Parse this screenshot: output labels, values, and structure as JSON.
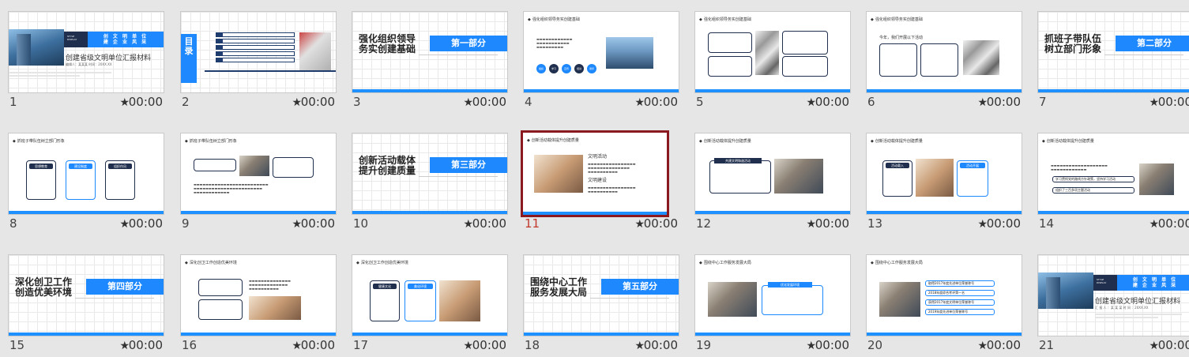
{
  "star_glyph": "★",
  "slides": [
    {
      "number": "1",
      "time": "00:00",
      "kind": "cover"
    },
    {
      "number": "2",
      "time": "00:00",
      "kind": "toc"
    },
    {
      "number": "3",
      "time": "00:00",
      "kind": "section"
    },
    {
      "number": "4",
      "time": "00:00",
      "kind": "content"
    },
    {
      "number": "5",
      "time": "00:00",
      "kind": "content"
    },
    {
      "number": "6",
      "time": "00:00",
      "kind": "content"
    },
    {
      "number": "7",
      "time": "00:00",
      "kind": "section"
    },
    {
      "number": "8",
      "time": "00:00",
      "kind": "content"
    },
    {
      "number": "9",
      "time": "00:00",
      "kind": "content"
    },
    {
      "number": "10",
      "time": "00:00",
      "kind": "section"
    },
    {
      "number": "11",
      "time": "00:00",
      "kind": "content",
      "selected": true
    },
    {
      "number": "12",
      "time": "00:00",
      "kind": "content"
    },
    {
      "number": "13",
      "time": "00:00",
      "kind": "content"
    },
    {
      "number": "14",
      "time": "00:00",
      "kind": "content"
    },
    {
      "number": "15",
      "time": "00:00",
      "kind": "section"
    },
    {
      "number": "16",
      "time": "00:00",
      "kind": "content"
    },
    {
      "number": "17",
      "time": "00:00",
      "kind": "content"
    },
    {
      "number": "18",
      "time": "00:00",
      "kind": "section"
    },
    {
      "number": "19",
      "time": "00:00",
      "kind": "content"
    },
    {
      "number": "20",
      "time": "00:00",
      "kind": "content"
    },
    {
      "number": "21",
      "time": "00:00",
      "kind": "cover"
    }
  ],
  "cover": {
    "badge": "STYLE\nDISPLAY",
    "band_line1": "创 文 明 单 位",
    "band_line2": "建 企 业 风 采",
    "title": "创建省级文明单位汇报材料",
    "meta": "编辑人：某某某  时间：20XX.XX",
    "closing_meta": "汇 报 人 ：某 某 某 时 间 ：20XX.XX"
  },
  "toc": {
    "label": "目录"
  },
  "sections": {
    "s3": {
      "title": "强化组织领导\n务实创建基础",
      "badge": "第一部分"
    },
    "s7": {
      "title": "抓班子带队伍\n树立部门形象",
      "badge": "第二部分"
    },
    "s10": {
      "title": "创新活动载体\n提升创建质量",
      "badge": "第三部分"
    },
    "s15": {
      "title": "深化创卫工作\n创造优美环境",
      "badge": "第四部分"
    },
    "s18": {
      "title": "围绕中心工作\n服务发展大局",
      "badge": "第五部分"
    }
  },
  "content": {
    "s4": {
      "header": "强化组织领导务实创建基础",
      "circles": [
        "组织",
        "学习",
        "宣传",
        "培训",
        "测评"
      ]
    },
    "s6": {
      "header": "强化组织领导务实创建基础",
      "heading": "今年，我们开展以下活动"
    },
    "s8": {
      "header": "抓班子带队伍树立部门形象",
      "labels": [
        "思想教育",
        "建设制度",
        "组织作风"
      ]
    },
    "s9": {
      "header": "抓班子带队伍树立部门形象"
    },
    "s11": {
      "header": "创新活动载体提升创建质量",
      "item1": "文明活动",
      "item2": "文明建设"
    },
    "s12": {
      "header": "创新活动载体提升创建质量",
      "label": "共建文明和谐活动"
    },
    "s13": {
      "header": "创新活动载体提升创建质量",
      "labels": [
        "活动载入",
        "活动开展"
      ]
    },
    "s14": {
      "header": "创新活动载体提升创建质量",
      "rows": [
        "学习贯彻党的路线方针政策，坚持学习活动",
        "组织了三百多项主题活动"
      ]
    },
    "s16": {
      "header": "深化创卫工作创造优美环境"
    },
    "s17": {
      "header": "深化创卫工作创造优美环境",
      "labels": [
        "健康文化",
        "美化环境"
      ]
    },
    "s19": {
      "header": "围绕中心工作服务发展大局",
      "label": "优化发展环境"
    },
    "s20": {
      "header": "围绕中心工作服务发展大局",
      "rows": [
        "取得2017年度先进单位荣誉称号",
        "2018年度综合考评第一名",
        "获得2017年度文明单位荣誉称号",
        "2019年度先进单位荣誉称号"
      ]
    }
  },
  "colors": {
    "accent": "#1e88ff",
    "navy": "#1f2f4d",
    "selected_border": "#8a1a1f",
    "selected_number": "#c0392b"
  }
}
